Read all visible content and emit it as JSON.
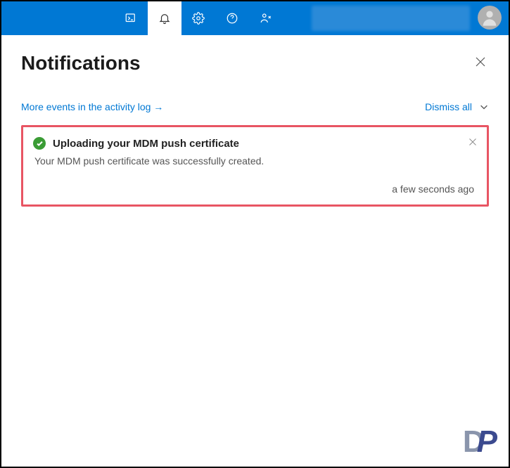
{
  "panel": {
    "title": "Notifications"
  },
  "actions": {
    "activity_link": "More events in the activity log →",
    "dismiss_all": "Dismiss all"
  },
  "notification": {
    "title": "Uploading your MDM push certificate",
    "body": "Your MDM push certificate was successfully created.",
    "timestamp": "a few seconds ago"
  }
}
